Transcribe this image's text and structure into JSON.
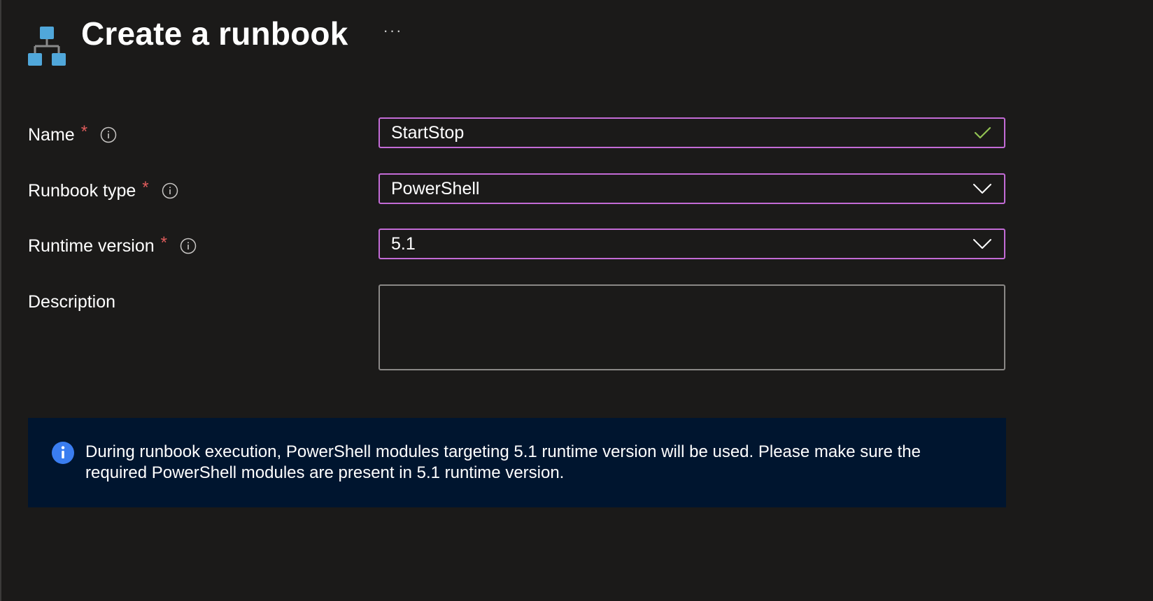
{
  "header": {
    "title": "Create a runbook",
    "more_label": "···",
    "icon": "runbook-hierarchy-icon"
  },
  "form": {
    "name": {
      "label": "Name",
      "required_marker": "*",
      "value": "StartStop",
      "valid": true
    },
    "runbook_type": {
      "label": "Runbook type",
      "required_marker": "*",
      "value": "PowerShell"
    },
    "runtime_version": {
      "label": "Runtime version",
      "required_marker": "*",
      "value": "5.1"
    },
    "description": {
      "label": "Description",
      "value": ""
    }
  },
  "banner": {
    "icon": "info-icon",
    "text": "During runbook execution, PowerShell modules targeting 5.1 runtime version will be used. Please make sure the required PowerShell modules are present in 5.1 runtime version."
  },
  "colors": {
    "background": "#1b1a19",
    "focus_border": "#c36bd6",
    "required": "#e05c5c",
    "valid_check": "#92c353",
    "banner_bg": "#00152f",
    "info_blue": "#3a7df0",
    "icon_blue": "#50a7da"
  }
}
